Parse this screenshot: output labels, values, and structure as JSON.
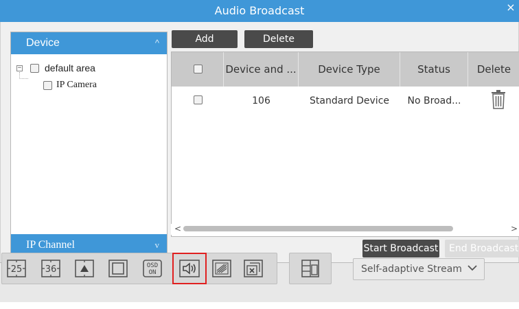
{
  "dialog": {
    "title": "Audio Broadcast",
    "close_glyph": "×"
  },
  "left_panel": {
    "device_header": "Device",
    "ip_channel_header": "IP Channel",
    "tree": {
      "root_label": "default area",
      "child_label": "IP Camera"
    }
  },
  "toolbar": {
    "add_label": "Add",
    "delete_label": "Delete"
  },
  "table": {
    "columns": [
      "Device and ...",
      "Device Type",
      "Status",
      "Delete"
    ],
    "rows": [
      {
        "device": "106",
        "type": "Standard Device",
        "status": "No Broad..."
      }
    ]
  },
  "actions": {
    "start_label": "Start Broadcast",
    "end_label": "End Broadcast"
  },
  "bottom_bar": {
    "layout_25_label": "25",
    "layout_36_label": "36",
    "osd_label_1": "OSD",
    "osd_label_2": "ON",
    "stream_label": "Self-adaptive Stream",
    "active_tool": "audio-broadcast"
  },
  "colors": {
    "title_bar": "#3f97d8",
    "dark_button": "#4a4a4a",
    "highlight": "#e02020"
  }
}
